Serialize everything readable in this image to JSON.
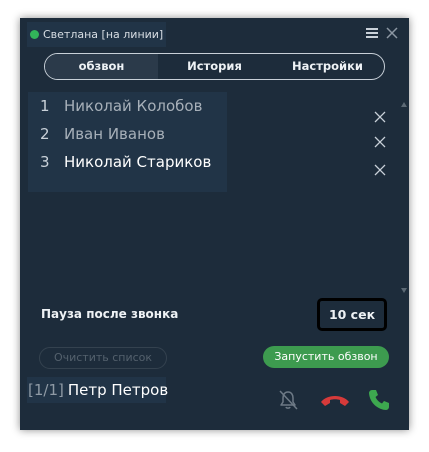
{
  "header": {
    "status_text": "Светлана [на линии]",
    "status_color": "#32b45a",
    "menu_icon": "hamburger-icon",
    "close_icon": "close-icon"
  },
  "tabs": [
    {
      "label": "обзвон",
      "active": true
    },
    {
      "label": "История",
      "active": false
    },
    {
      "label": "Настройки",
      "active": false
    }
  ],
  "queue": [
    {
      "num": "1",
      "name": "Николай Колобов",
      "selected": false
    },
    {
      "num": "2",
      "name": "Иван Иванов",
      "selected": false
    },
    {
      "num": "3",
      "name": "Николай Стариков",
      "selected": true
    }
  ],
  "pause": {
    "label": "Пауза после звонка",
    "value": "10 сек"
  },
  "buttons": {
    "clear_label": "Очистить список",
    "start_label": "Запустить обзвон"
  },
  "current_call": {
    "counter": "[1/1]",
    "name": "Петр Петров"
  },
  "controls": {
    "mute_icon": "bell-off-icon",
    "hangup_icon": "phone-hangup-icon",
    "call_icon": "phone-icon",
    "hangup_color": "#d63a3a",
    "call_color": "#3da84f"
  }
}
